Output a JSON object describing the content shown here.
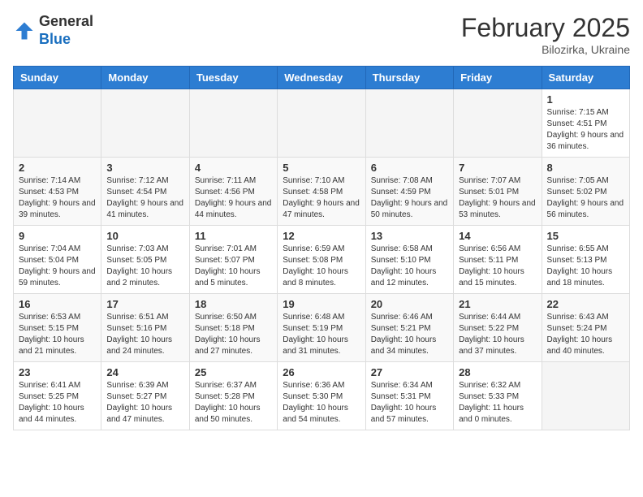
{
  "header": {
    "logo_general": "General",
    "logo_blue": "Blue",
    "month_title": "February 2025",
    "subtitle": "Bilozirka, Ukraine"
  },
  "weekdays": [
    "Sunday",
    "Monday",
    "Tuesday",
    "Wednesday",
    "Thursday",
    "Friday",
    "Saturday"
  ],
  "weeks": [
    [
      {
        "day": "",
        "info": ""
      },
      {
        "day": "",
        "info": ""
      },
      {
        "day": "",
        "info": ""
      },
      {
        "day": "",
        "info": ""
      },
      {
        "day": "",
        "info": ""
      },
      {
        "day": "",
        "info": ""
      },
      {
        "day": "1",
        "info": "Sunrise: 7:15 AM\nSunset: 4:51 PM\nDaylight: 9 hours and 36 minutes."
      }
    ],
    [
      {
        "day": "2",
        "info": "Sunrise: 7:14 AM\nSunset: 4:53 PM\nDaylight: 9 hours and 39 minutes."
      },
      {
        "day": "3",
        "info": "Sunrise: 7:12 AM\nSunset: 4:54 PM\nDaylight: 9 hours and 41 minutes."
      },
      {
        "day": "4",
        "info": "Sunrise: 7:11 AM\nSunset: 4:56 PM\nDaylight: 9 hours and 44 minutes."
      },
      {
        "day": "5",
        "info": "Sunrise: 7:10 AM\nSunset: 4:58 PM\nDaylight: 9 hours and 47 minutes."
      },
      {
        "day": "6",
        "info": "Sunrise: 7:08 AM\nSunset: 4:59 PM\nDaylight: 9 hours and 50 minutes."
      },
      {
        "day": "7",
        "info": "Sunrise: 7:07 AM\nSunset: 5:01 PM\nDaylight: 9 hours and 53 minutes."
      },
      {
        "day": "8",
        "info": "Sunrise: 7:05 AM\nSunset: 5:02 PM\nDaylight: 9 hours and 56 minutes."
      }
    ],
    [
      {
        "day": "9",
        "info": "Sunrise: 7:04 AM\nSunset: 5:04 PM\nDaylight: 9 hours and 59 minutes."
      },
      {
        "day": "10",
        "info": "Sunrise: 7:03 AM\nSunset: 5:05 PM\nDaylight: 10 hours and 2 minutes."
      },
      {
        "day": "11",
        "info": "Sunrise: 7:01 AM\nSunset: 5:07 PM\nDaylight: 10 hours and 5 minutes."
      },
      {
        "day": "12",
        "info": "Sunrise: 6:59 AM\nSunset: 5:08 PM\nDaylight: 10 hours and 8 minutes."
      },
      {
        "day": "13",
        "info": "Sunrise: 6:58 AM\nSunset: 5:10 PM\nDaylight: 10 hours and 12 minutes."
      },
      {
        "day": "14",
        "info": "Sunrise: 6:56 AM\nSunset: 5:11 PM\nDaylight: 10 hours and 15 minutes."
      },
      {
        "day": "15",
        "info": "Sunrise: 6:55 AM\nSunset: 5:13 PM\nDaylight: 10 hours and 18 minutes."
      }
    ],
    [
      {
        "day": "16",
        "info": "Sunrise: 6:53 AM\nSunset: 5:15 PM\nDaylight: 10 hours and 21 minutes."
      },
      {
        "day": "17",
        "info": "Sunrise: 6:51 AM\nSunset: 5:16 PM\nDaylight: 10 hours and 24 minutes."
      },
      {
        "day": "18",
        "info": "Sunrise: 6:50 AM\nSunset: 5:18 PM\nDaylight: 10 hours and 27 minutes."
      },
      {
        "day": "19",
        "info": "Sunrise: 6:48 AM\nSunset: 5:19 PM\nDaylight: 10 hours and 31 minutes."
      },
      {
        "day": "20",
        "info": "Sunrise: 6:46 AM\nSunset: 5:21 PM\nDaylight: 10 hours and 34 minutes."
      },
      {
        "day": "21",
        "info": "Sunrise: 6:44 AM\nSunset: 5:22 PM\nDaylight: 10 hours and 37 minutes."
      },
      {
        "day": "22",
        "info": "Sunrise: 6:43 AM\nSunset: 5:24 PM\nDaylight: 10 hours and 40 minutes."
      }
    ],
    [
      {
        "day": "23",
        "info": "Sunrise: 6:41 AM\nSunset: 5:25 PM\nDaylight: 10 hours and 44 minutes."
      },
      {
        "day": "24",
        "info": "Sunrise: 6:39 AM\nSunset: 5:27 PM\nDaylight: 10 hours and 47 minutes."
      },
      {
        "day": "25",
        "info": "Sunrise: 6:37 AM\nSunset: 5:28 PM\nDaylight: 10 hours and 50 minutes."
      },
      {
        "day": "26",
        "info": "Sunrise: 6:36 AM\nSunset: 5:30 PM\nDaylight: 10 hours and 54 minutes."
      },
      {
        "day": "27",
        "info": "Sunrise: 6:34 AM\nSunset: 5:31 PM\nDaylight: 10 hours and 57 minutes."
      },
      {
        "day": "28",
        "info": "Sunrise: 6:32 AM\nSunset: 5:33 PM\nDaylight: 11 hours and 0 minutes."
      },
      {
        "day": "",
        "info": ""
      }
    ]
  ]
}
